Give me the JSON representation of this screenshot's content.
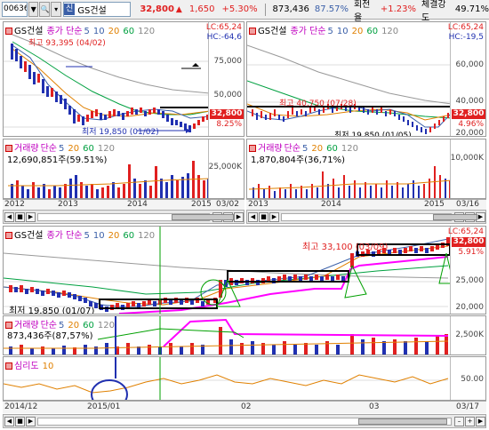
{
  "toolbar": {
    "code": "006360",
    "name_badge": "신",
    "name": "GS건설",
    "price": "32,800",
    "change": "1,650",
    "change_pct": "+5.30%",
    "volume": "873,436",
    "volume_pct": "87.57%",
    "turnover_label": "회전율",
    "turnover": "+1.23%",
    "strength_label": "체결강도",
    "strength": "49.71%"
  },
  "ma_labels": {
    "type": "종가 단순",
    "p5": "5",
    "p10": "10",
    "p20": "20",
    "p60": "60",
    "p120": "120"
  },
  "vol_labels": {
    "title": "거래량",
    "type": "단순",
    "p5": "5",
    "p20": "20",
    "p60": "60",
    "p120": "120"
  },
  "panel1": {
    "name": "GS건설",
    "lc": "LC:65,24",
    "hc": "HC:-64,6",
    "high": "최고 93,395 (04/02)",
    "low": "최저 19,850 (01/02)",
    "ticks": [
      "75,000",
      "50,000",
      "25,000"
    ],
    "price_tag": "32,800",
    "pct_tag": "8.25%",
    "vol_value": "12,690,851주(59.51%)",
    "vol_tick": "25,000K",
    "dates": [
      "2012",
      "2013",
      "2014",
      "2015",
      "03/02"
    ]
  },
  "panel2": {
    "name": "GS건설",
    "lc": "LC:65,24",
    "hc": "HC:-19,5",
    "high": "최고 40,750 (07/28)",
    "low": "최저 19,850 (01/05)",
    "ticks": [
      "60,000",
      "40,000",
      "20,000"
    ],
    "price_tag": "32,800",
    "pct_tag": "4.96%",
    "vol_value": "1,870,804주(36,71%)",
    "vol_tick": "10,000K",
    "dates": [
      "2013",
      "2014",
      "2015",
      "03/16"
    ]
  },
  "panel3": {
    "name": "GS건설",
    "lc": "LC:65,24",
    "high": "최고 33,100 (03/09)",
    "low": "최저 19,850 (01/07)",
    "ticks": [
      "25,000",
      "20,000"
    ],
    "price_tag": "32,800",
    "pct_tag": "5.91%",
    "vol_value": "873,436주(87,57%)",
    "vol_tick": "2,500K",
    "psy_label": "심리도",
    "psy_period": "10",
    "psy_tick": "50.00",
    "dates": [
      "2014/12",
      "2015/01",
      "02",
      "03",
      "03/17"
    ]
  },
  "colors": {
    "up": "#e02020",
    "down": "#2030b0",
    "ma5": "#3a5fa8",
    "ma20": "#e08000",
    "ma60": "#00a040",
    "ma120": "#888888",
    "annot": "#ff00ff",
    "green_annot": "#00a000"
  }
}
